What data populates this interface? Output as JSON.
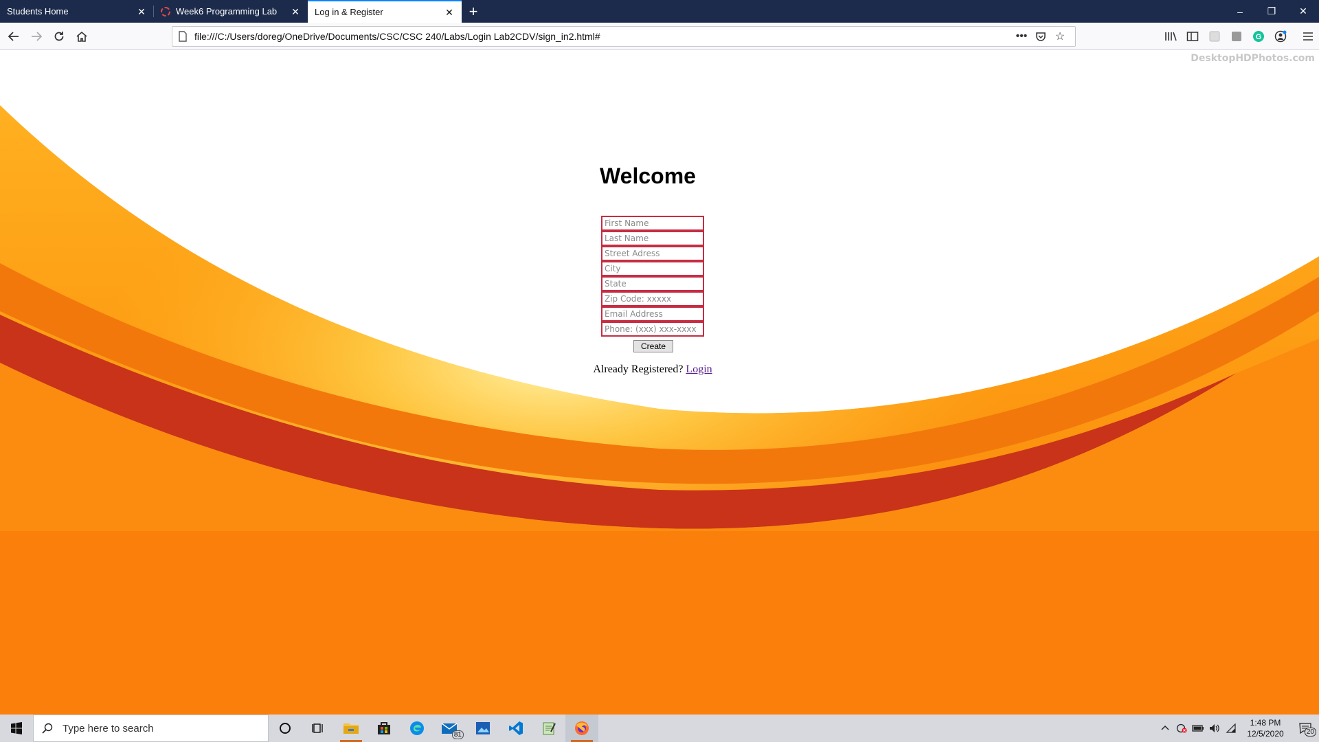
{
  "browser": {
    "tabs": [
      {
        "title": "Students Home",
        "active": false
      },
      {
        "title": "Week6 Programming Lab",
        "active": false
      },
      {
        "title": "Log in & Register",
        "active": true
      }
    ],
    "url": "file:///C:/Users/doreg/OneDrive/Documents/CSC/CSC 240/Labs/Login Lab2CDV/sign_in2.html#",
    "new_tab_symbol": "+",
    "window_controls": {
      "minimize": "–",
      "restore": "❐",
      "close": "✕"
    }
  },
  "page": {
    "watermark": "DesktopHDPhotos.com",
    "heading": "Welcome",
    "fields": [
      {
        "name": "first-name-input",
        "placeholder": "First Name",
        "value": ""
      },
      {
        "name": "last-name-input",
        "placeholder": "Last Name",
        "value": ""
      },
      {
        "name": "street-address-input",
        "placeholder": "Street Adress",
        "value": ""
      },
      {
        "name": "city-input",
        "placeholder": "City",
        "value": ""
      },
      {
        "name": "state-input",
        "placeholder": "State",
        "value": ""
      },
      {
        "name": "zip-code-input",
        "placeholder": "Zip Code: xxxxx",
        "value": ""
      },
      {
        "name": "email-address-input",
        "placeholder": "Email Address",
        "value": ""
      },
      {
        "name": "phone-input",
        "placeholder": "Phone: (xxx) xxx-xxxx",
        "value": ""
      }
    ],
    "create_label": "Create",
    "registered_text": "Already Registered?",
    "login_link": "Login"
  },
  "taskbar": {
    "search_placeholder": "Type here to search",
    "mail_badge": "81",
    "time": "1:48 PM",
    "date": "12/5/2020",
    "notification_count": "20"
  },
  "colors": {
    "tabstrip": "#1c2b4b",
    "accent": "#0a84ff",
    "field_border": "#c62d42",
    "orange_light": "#ffa51e",
    "orange_dark": "#f86c0a",
    "red_band": "#c8331a"
  }
}
